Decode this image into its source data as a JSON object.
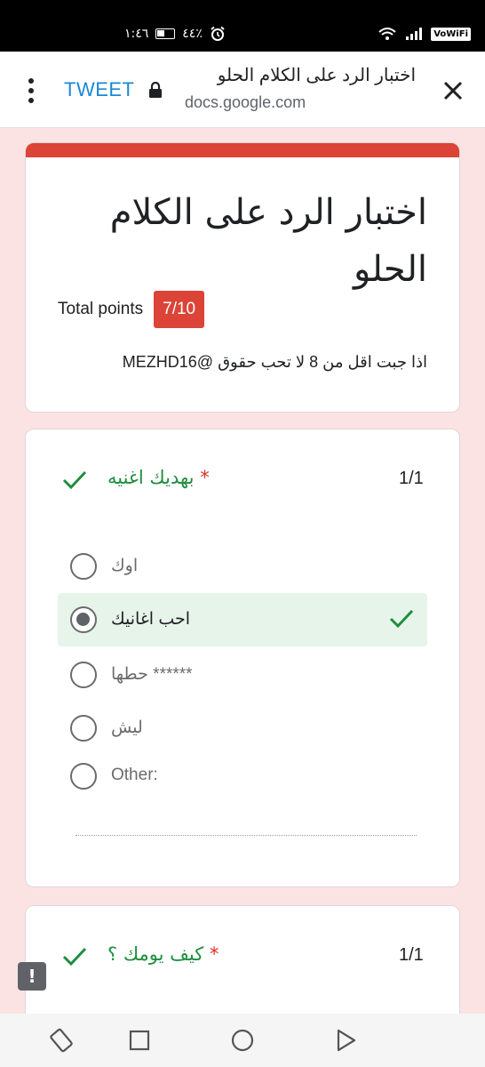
{
  "status_bar": {
    "time": "١:٤٦",
    "battery": "٤٤٪",
    "vowifi_label": "VoWiFi"
  },
  "browser": {
    "tweet_label": "TWEET",
    "page_title": "اختبار الرد على الكلام الحلو",
    "host": "docs.google.com"
  },
  "form": {
    "title": "اختبار الرد على الكلام الحلو",
    "total_points_label": "Total points",
    "score": "7/10",
    "description": "اذا جبت اقل من 8 لا تحب حقوق @MEZHD16",
    "accent_color": "#db4437"
  },
  "questions": [
    {
      "title": "بهديك اغنيه",
      "required_mark": "*",
      "points": "1/1",
      "options": [
        {
          "label": "اوك",
          "selected": false
        },
        {
          "label": "احب اغانيك",
          "selected": true,
          "correct": true
        },
        {
          "label": "حطها ******",
          "selected": false
        },
        {
          "label": "ليش",
          "selected": false
        },
        {
          "label": "Other:",
          "selected": false
        }
      ]
    },
    {
      "title": "كيف يومك ؟",
      "required_mark": "*",
      "points": "1/1"
    }
  ],
  "feedback_icon": "!",
  "colors": {
    "correct_green": "#1e8e3e",
    "selected_bg": "#e6f4ea",
    "page_bg": "#fbe3e3"
  }
}
